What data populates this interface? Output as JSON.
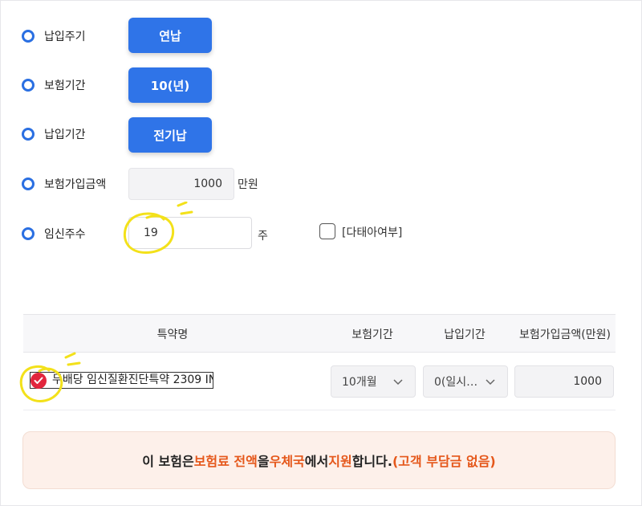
{
  "form": {
    "payment_cycle": {
      "label": "납입주기",
      "value": "연납"
    },
    "insurance_period": {
      "label": "보험기간",
      "value": "10(년)"
    },
    "payment_period": {
      "label": "납입기간",
      "value": "전기납"
    },
    "sum_insured": {
      "label": "보험가입금액",
      "value": "1000",
      "unit": "만원"
    },
    "pregnancy_weeks": {
      "label": "임신주수",
      "value": "19",
      "unit": "주"
    },
    "twin": {
      "label": "[다태아여부]",
      "checked": false
    }
  },
  "rider_table": {
    "headers": {
      "name": "특약명",
      "insurance_period": "보험기간",
      "payment_period": "납입기간",
      "amount": "보험가입금액(만원)"
    },
    "rows": [
      {
        "checked": true,
        "name": "무배당 임신질환진단특약 2309 IN",
        "insurance_period": "10개월",
        "payment_period": "0(일시…",
        "amount": "1000"
      }
    ]
  },
  "banner": {
    "p1": "이 보험은 ",
    "h1": "보험료 전액",
    "p2": "을 ",
    "h2": "우체국",
    "p3": "에서 ",
    "h3": "지원",
    "p4": "합니다.",
    "h4": "(고객 부담금 없음)"
  },
  "colors": {
    "primary": "#2f74e8",
    "check_red": "#e2263d",
    "highlight_orange": "#e5571a",
    "banner_bg": "#fdf0ea",
    "annotation_yellow": "#f3e11a"
  }
}
